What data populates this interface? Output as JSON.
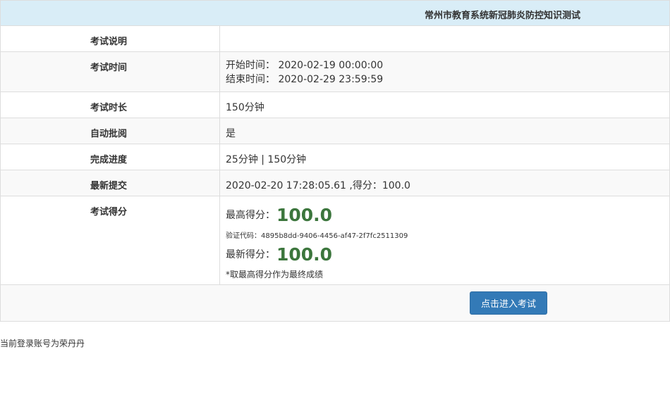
{
  "header": {
    "title": "常州市教育系统新冠肺炎防控知识测试"
  },
  "rows": [
    {
      "label": "考试说明",
      "value": ""
    },
    {
      "label": "考试时间",
      "start_label": "开始时间：",
      "start_value": "2020-02-19 00:00:00",
      "end_label": "结束时间：",
      "end_value": "2020-02-29 23:59:59"
    },
    {
      "label": "考试时长",
      "value": "150分钟"
    },
    {
      "label": "自动批阅",
      "value": "是"
    },
    {
      "label": "完成进度",
      "value": "25分钟 | 150分钟"
    },
    {
      "label": "最新提交",
      "value": "2020-02-20 17:28:05.61 ,得分：100.0"
    },
    {
      "label": "考试得分",
      "highest_label": "最高得分：",
      "highest_score": "100.0",
      "verify_text": "验证代码：4895b8dd-9406-4456-af47-2f7fc2511309",
      "latest_label": "最新得分：",
      "latest_score": "100.0",
      "note": "*取最高得分作为最终成绩"
    }
  ],
  "actions": {
    "enter_label": "点击进入考试"
  },
  "footer": {
    "login_text": "当前登录账号为荣丹丹"
  },
  "colors": {
    "header_bg": "#d9edf7",
    "score_green": "#3c763d",
    "button_blue": "#337ab7"
  }
}
